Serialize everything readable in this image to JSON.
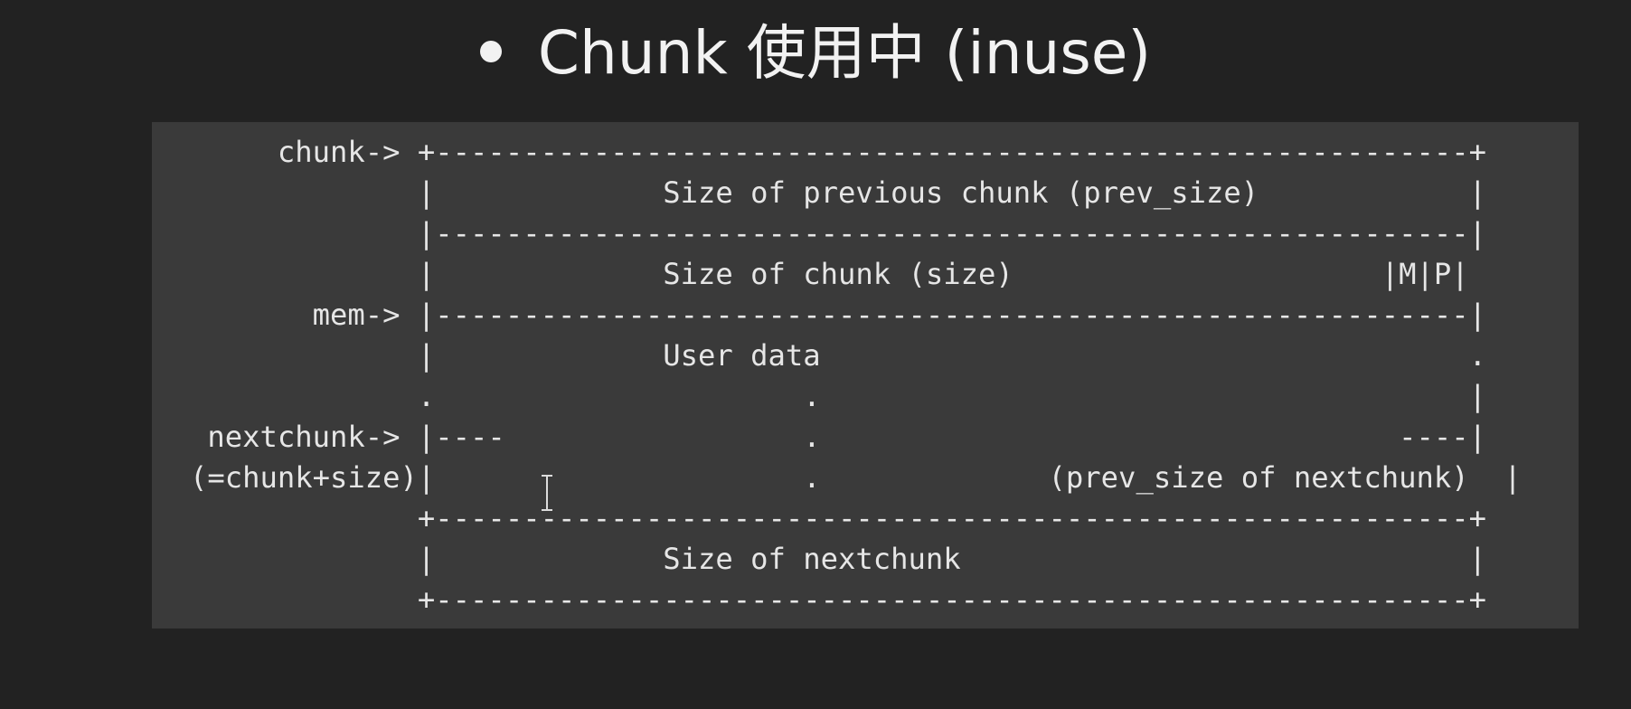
{
  "title": {
    "bullet_icon": "bullet-dot",
    "text": "Chunk 使用中 (inuse)"
  },
  "diagram": {
    "lines": [
      "     chunk-> +-----------------------------------------------------------+",
      "             |             Size of previous chunk (prev_size)            |",
      "             |-----------------------------------------------------------|",
      "             |             Size of chunk (size)                     |M|P|",
      "       mem-> |-----------------------------------------------------------|",
      "             |             User data                                     .",
      "             .                     .                                     |",
      " nextchunk-> |----                 .                                 ----|",
      "(=chunk+size)|                     .             (prev_size of nextchunk)  |",
      "             +-----------------------------------------------------------+",
      "             |             Size of nextchunk                             |",
      "             +-----------------------------------------------------------+"
    ]
  },
  "cursor_icon": "text-cursor-ibeam"
}
